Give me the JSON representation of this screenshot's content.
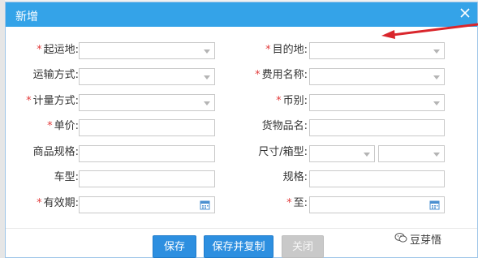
{
  "dialog": {
    "title": "新增",
    "close_icon": "close-icon"
  },
  "fields": {
    "origin": {
      "label": "起运地:",
      "required": true,
      "type": "select",
      "value": ""
    },
    "destination": {
      "label": "目的地:",
      "required": true,
      "type": "select",
      "value": ""
    },
    "transport_mode": {
      "label": "运输方式:",
      "required": false,
      "type": "select",
      "value": ""
    },
    "fee_name": {
      "label": "费用名称:",
      "required": true,
      "type": "select",
      "value": ""
    },
    "billing_mode": {
      "label": "计量方式:",
      "required": true,
      "type": "select",
      "value": ""
    },
    "currency": {
      "label": "币别:",
      "required": true,
      "type": "select",
      "value": ""
    },
    "unit_price": {
      "label": "单价:",
      "required": true,
      "type": "text",
      "value": ""
    },
    "goods_name": {
      "label": "货物品名:",
      "required": false,
      "type": "text",
      "value": ""
    },
    "goods_spec": {
      "label": "商品规格:",
      "required": false,
      "type": "text",
      "value": ""
    },
    "size_container": {
      "label": "尺寸/箱型:",
      "required": false,
      "type": "select-pair",
      "value": ""
    },
    "vehicle_type": {
      "label": "车型:",
      "required": false,
      "type": "text",
      "value": ""
    },
    "spec": {
      "label": "规格:",
      "required": false,
      "type": "text",
      "value": ""
    },
    "valid_from": {
      "label": "有效期:",
      "required": true,
      "type": "date",
      "value": ""
    },
    "valid_to": {
      "label": "至:",
      "required": true,
      "type": "date",
      "value": ""
    }
  },
  "buttons": {
    "save": "保存",
    "save_copy": "保存并复制",
    "close": "关闭"
  },
  "watermark": {
    "text": "豆芽悟"
  },
  "colors": {
    "title_bar": "#34a3e8",
    "primary": "#2d8fe0",
    "required": "#e23b3b",
    "arrow": "#d9262c"
  }
}
